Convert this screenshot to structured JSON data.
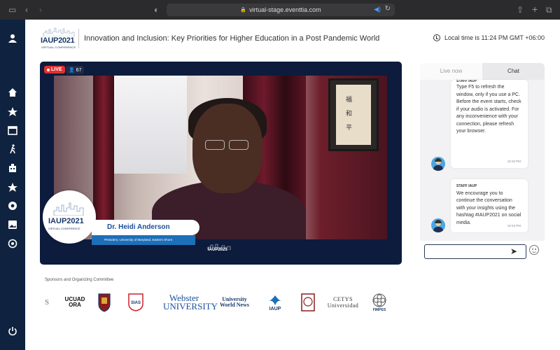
{
  "browser": {
    "url": "virtual-stage.eventtia.com"
  },
  "header": {
    "logo_main": "IAUP2021",
    "logo_sub": "VIRTUAL CONFERENCE",
    "title": "Innovation and Inclusion: Key Priorities for Higher Education in a Post Pandemic World",
    "local_time": "Local time is 11:24 PM GMT +06:00"
  },
  "sidebar": {
    "items": [
      {
        "icon": "user-icon"
      },
      {
        "icon": "home-icon"
      },
      {
        "icon": "star-icon"
      },
      {
        "icon": "calendar-icon"
      },
      {
        "icon": "walking-icon"
      },
      {
        "icon": "building-icon"
      },
      {
        "icon": "star-icon"
      },
      {
        "icon": "aperture-icon"
      },
      {
        "icon": "image-icon"
      },
      {
        "icon": "location-icon"
      },
      {
        "icon": "power-icon"
      }
    ]
  },
  "video": {
    "live_label": "LIVE",
    "viewer_count": "67",
    "speaker_name": "Dr. Heidi Anderson",
    "speaker_role": "President, University of Maryland, Eastern Shore",
    "badge_main": "IAUP2021",
    "badge_sub": "VIRTUAL CONFERENCE",
    "watermark": "IAUP2021"
  },
  "chat": {
    "tabs": [
      "Live now",
      "Chat"
    ],
    "active_tab": "Chat",
    "messages": [
      {
        "author": "STAFF IAUP",
        "text": "Type F5 to refresh the window, only if you use a PC. Before the event starts, check if your audio is activated. For any inconvenience with your connection, please refresh your browser.",
        "time": "10:33 PM"
      },
      {
        "author": "STAFF IAUP",
        "text": "We encourage you to continue the conversation with your insights using the hashtag #IAUP2021 on social media.",
        "time": "10:43 PM"
      }
    ],
    "input_placeholder": ""
  },
  "sponsors": {
    "title": "Sponsors and Organizing Committee",
    "logos": [
      "S",
      "UCUADORA",
      "crest",
      "SIAS",
      "Webster UNIVERSITY",
      "University World News",
      "IAUP",
      "seal",
      "CETYS Universidad",
      "FIMPES"
    ]
  },
  "colors": {
    "sidebar": "#0f2340",
    "live": "#e0312f",
    "brand_blue": "#1b3a6b",
    "accent_blue": "#1d6fb8"
  }
}
